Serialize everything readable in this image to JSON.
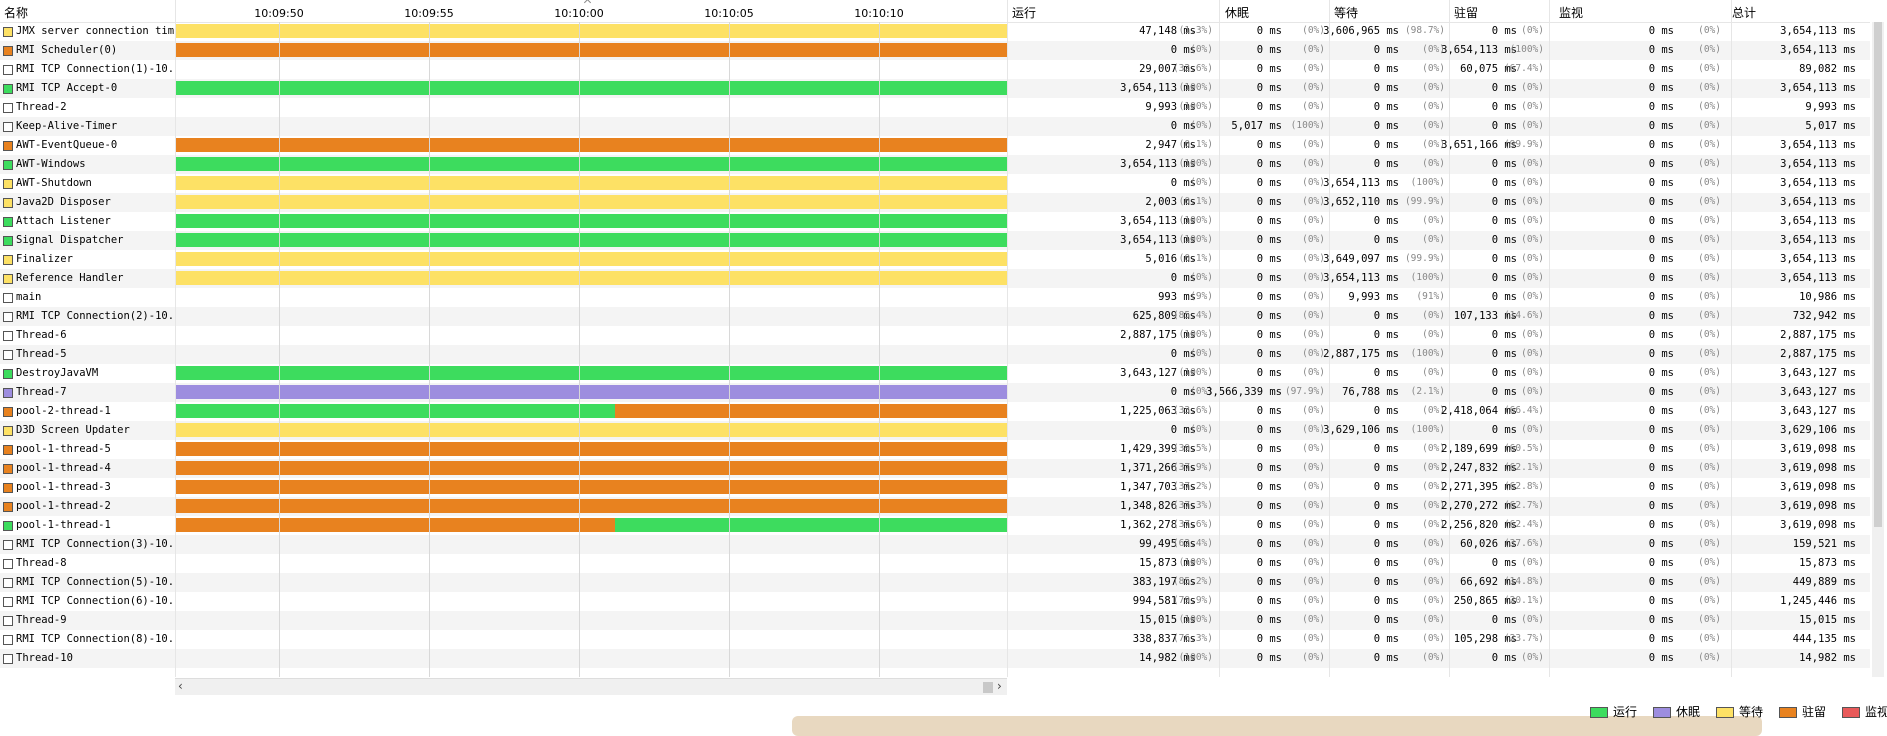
{
  "header": {
    "name_col": "名称",
    "run_col": "运行",
    "sleep_col": "休眠",
    "wait_col": "等待",
    "park_col": "驻留",
    "monitor_col": "监视",
    "total_col": "总计",
    "time_ticks": [
      "10:09:50",
      "10:09:55",
      "10:10:00",
      "10:10:05",
      "10:10:10"
    ]
  },
  "colors": {
    "running": "#3ddc5e",
    "sleeping": "#9d8ddf",
    "waiting": "#fde165",
    "parked": "#e8821f",
    "monitor": "#e85a5a"
  },
  "threads": [
    {
      "name": "JMX server connection timeout",
      "state_color": "#fde165",
      "segments": [
        {
          "state": "waiting",
          "from": 0,
          "to": 1
        }
      ],
      "run": "47,148 ms",
      "run_pct": "(1.3%)",
      "sleep": "0 ms",
      "sleep_pct": "(0%)",
      "wait": "3,606,965 ms",
      "wait_pct": "(98.7%)",
      "park": "0 ms",
      "park_pct": "(0%)",
      "monitor": "0 ms",
      "monitor_pct": "(0%)",
      "total": "3,654,113 ms"
    },
    {
      "name": "RMI Scheduler(0)",
      "state_color": "#e8821f",
      "segments": [
        {
          "state": "parked",
          "from": 0,
          "to": 1
        }
      ],
      "run": "0 ms",
      "run_pct": "(0%)",
      "sleep": "0 ms",
      "sleep_pct": "(0%)",
      "wait": "0 ms",
      "wait_pct": "(0%)",
      "park": "3,654,113 ms",
      "park_pct": "(100%)",
      "monitor": "0 ms",
      "monitor_pct": "(0%)",
      "total": "3,654,113 ms"
    },
    {
      "name": "RMI TCP Connection(1)-10.10",
      "state_color": "#ffffff",
      "segments": [],
      "run": "29,007 ms",
      "run_pct": "(32.6%)",
      "sleep": "0 ms",
      "sleep_pct": "(0%)",
      "wait": "0 ms",
      "wait_pct": "(0%)",
      "park": "60,075 ms",
      "park_pct": "(67.4%)",
      "monitor": "0 ms",
      "monitor_pct": "(0%)",
      "total": "89,082 ms"
    },
    {
      "name": "RMI TCP Accept-0",
      "state_color": "#3ddc5e",
      "segments": [
        {
          "state": "running",
          "from": 0,
          "to": 1
        }
      ],
      "run": "3,654,113 ms",
      "run_pct": "(100%)",
      "sleep": "0 ms",
      "sleep_pct": "(0%)",
      "wait": "0 ms",
      "wait_pct": "(0%)",
      "park": "0 ms",
      "park_pct": "(0%)",
      "monitor": "0 ms",
      "monitor_pct": "(0%)",
      "total": "3,654,113 ms"
    },
    {
      "name": "Thread-2",
      "state_color": "#ffffff",
      "segments": [],
      "run": "9,993 ms",
      "run_pct": "(100%)",
      "sleep": "0 ms",
      "sleep_pct": "(0%)",
      "wait": "0 ms",
      "wait_pct": "(0%)",
      "park": "0 ms",
      "park_pct": "(0%)",
      "monitor": "0 ms",
      "monitor_pct": "(0%)",
      "total": "9,993 ms"
    },
    {
      "name": "Keep-Alive-Timer",
      "state_color": "#ffffff",
      "segments": [],
      "run": "0 ms",
      "run_pct": "(0%)",
      "sleep": "5,017 ms",
      "sleep_pct": "(100%)",
      "wait": "0 ms",
      "wait_pct": "(0%)",
      "park": "0 ms",
      "park_pct": "(0%)",
      "monitor": "0 ms",
      "monitor_pct": "(0%)",
      "total": "5,017 ms"
    },
    {
      "name": "AWT-EventQueue-0",
      "state_color": "#e8821f",
      "segments": [
        {
          "state": "parked",
          "from": 0,
          "to": 1
        }
      ],
      "run": "2,947 ms",
      "run_pct": "(0.1%)",
      "sleep": "0 ms",
      "sleep_pct": "(0%)",
      "wait": "0 ms",
      "wait_pct": "(0%)",
      "park": "3,651,166 ms",
      "park_pct": "(99.9%)",
      "monitor": "0 ms",
      "monitor_pct": "(0%)",
      "total": "3,654,113 ms"
    },
    {
      "name": "AWT-Windows",
      "state_color": "#3ddc5e",
      "segments": [
        {
          "state": "running",
          "from": 0,
          "to": 1
        }
      ],
      "run": "3,654,113 ms",
      "run_pct": "(100%)",
      "sleep": "0 ms",
      "sleep_pct": "(0%)",
      "wait": "0 ms",
      "wait_pct": "(0%)",
      "park": "0 ms",
      "park_pct": "(0%)",
      "monitor": "0 ms",
      "monitor_pct": "(0%)",
      "total": "3,654,113 ms"
    },
    {
      "name": "AWT-Shutdown",
      "state_color": "#fde165",
      "segments": [
        {
          "state": "waiting",
          "from": 0,
          "to": 1
        }
      ],
      "run": "0 ms",
      "run_pct": "(0%)",
      "sleep": "0 ms",
      "sleep_pct": "(0%)",
      "wait": "3,654,113 ms",
      "wait_pct": "(100%)",
      "park": "0 ms",
      "park_pct": "(0%)",
      "monitor": "0 ms",
      "monitor_pct": "(0%)",
      "total": "3,654,113 ms"
    },
    {
      "name": "Java2D Disposer",
      "state_color": "#fde165",
      "segments": [
        {
          "state": "waiting",
          "from": 0,
          "to": 1
        }
      ],
      "run": "2,003 ms",
      "run_pct": "(0.1%)",
      "sleep": "0 ms",
      "sleep_pct": "(0%)",
      "wait": "3,652,110 ms",
      "wait_pct": "(99.9%)",
      "park": "0 ms",
      "park_pct": "(0%)",
      "monitor": "0 ms",
      "monitor_pct": "(0%)",
      "total": "3,654,113 ms"
    },
    {
      "name": "Attach Listener",
      "state_color": "#3ddc5e",
      "segments": [
        {
          "state": "running",
          "from": 0,
          "to": 1
        }
      ],
      "run": "3,654,113 ms",
      "run_pct": "(100%)",
      "sleep": "0 ms",
      "sleep_pct": "(0%)",
      "wait": "0 ms",
      "wait_pct": "(0%)",
      "park": "0 ms",
      "park_pct": "(0%)",
      "monitor": "0 ms",
      "monitor_pct": "(0%)",
      "total": "3,654,113 ms"
    },
    {
      "name": "Signal Dispatcher",
      "state_color": "#3ddc5e",
      "segments": [
        {
          "state": "running",
          "from": 0,
          "to": 1
        }
      ],
      "run": "3,654,113 ms",
      "run_pct": "(100%)",
      "sleep": "0 ms",
      "sleep_pct": "(0%)",
      "wait": "0 ms",
      "wait_pct": "(0%)",
      "park": "0 ms",
      "park_pct": "(0%)",
      "monitor": "0 ms",
      "monitor_pct": "(0%)",
      "total": "3,654,113 ms"
    },
    {
      "name": "Finalizer",
      "state_color": "#fde165",
      "segments": [
        {
          "state": "waiting",
          "from": 0,
          "to": 1
        }
      ],
      "run": "5,016 ms",
      "run_pct": "(0.1%)",
      "sleep": "0 ms",
      "sleep_pct": "(0%)",
      "wait": "3,649,097 ms",
      "wait_pct": "(99.9%)",
      "park": "0 ms",
      "park_pct": "(0%)",
      "monitor": "0 ms",
      "monitor_pct": "(0%)",
      "total": "3,654,113 ms"
    },
    {
      "name": "Reference Handler",
      "state_color": "#fde165",
      "segments": [
        {
          "state": "waiting",
          "from": 0,
          "to": 1
        }
      ],
      "run": "0 ms",
      "run_pct": "(0%)",
      "sleep": "0 ms",
      "sleep_pct": "(0%)",
      "wait": "3,654,113 ms",
      "wait_pct": "(100%)",
      "park": "0 ms",
      "park_pct": "(0%)",
      "monitor": "0 ms",
      "monitor_pct": "(0%)",
      "total": "3,654,113 ms"
    },
    {
      "name": "main",
      "state_color": "#ffffff",
      "segments": [],
      "run": "993 ms",
      "run_pct": "(9%)",
      "sleep": "0 ms",
      "sleep_pct": "(0%)",
      "wait": "9,993 ms",
      "wait_pct": "(91%)",
      "park": "0 ms",
      "park_pct": "(0%)",
      "monitor": "0 ms",
      "monitor_pct": "(0%)",
      "total": "10,986 ms"
    },
    {
      "name": "RMI TCP Connection(2)-10.10",
      "state_color": "#ffffff",
      "segments": [],
      "run": "625,809 ms",
      "run_pct": "(85.4%)",
      "sleep": "0 ms",
      "sleep_pct": "(0%)",
      "wait": "0 ms",
      "wait_pct": "(0%)",
      "park": "107,133 ms",
      "park_pct": "(14.6%)",
      "monitor": "0 ms",
      "monitor_pct": "(0%)",
      "total": "732,942 ms"
    },
    {
      "name": "Thread-6",
      "state_color": "#ffffff",
      "segments": [],
      "run": "2,887,175 ms",
      "run_pct": "(100%)",
      "sleep": "0 ms",
      "sleep_pct": "(0%)",
      "wait": "0 ms",
      "wait_pct": "(0%)",
      "park": "0 ms",
      "park_pct": "(0%)",
      "monitor": "0 ms",
      "monitor_pct": "(0%)",
      "total": "2,887,175 ms"
    },
    {
      "name": "Thread-5",
      "state_color": "#ffffff",
      "segments": [],
      "run": "0 ms",
      "run_pct": "(0%)",
      "sleep": "0 ms",
      "sleep_pct": "(0%)",
      "wait": "2,887,175 ms",
      "wait_pct": "(100%)",
      "park": "0 ms",
      "park_pct": "(0%)",
      "monitor": "0 ms",
      "monitor_pct": "(0%)",
      "total": "2,887,175 ms"
    },
    {
      "name": "DestroyJavaVM",
      "state_color": "#3ddc5e",
      "segments": [
        {
          "state": "running",
          "from": 0,
          "to": 1
        }
      ],
      "run": "3,643,127 ms",
      "run_pct": "(100%)",
      "sleep": "0 ms",
      "sleep_pct": "(0%)",
      "wait": "0 ms",
      "wait_pct": "(0%)",
      "park": "0 ms",
      "park_pct": "(0%)",
      "monitor": "0 ms",
      "monitor_pct": "(0%)",
      "total": "3,643,127 ms"
    },
    {
      "name": "Thread-7",
      "state_color": "#9d8ddf",
      "segments": [
        {
          "state": "sleeping",
          "from": 0,
          "to": 1
        }
      ],
      "run": "0 ms",
      "run_pct": "(0%)",
      "sleep": "3,566,339 ms",
      "sleep_pct": "(97.9%)",
      "wait": "76,788 ms",
      "wait_pct": "(2.1%)",
      "park": "0 ms",
      "park_pct": "(0%)",
      "monitor": "0 ms",
      "monitor_pct": "(0%)",
      "total": "3,643,127 ms"
    },
    {
      "name": "pool-2-thread-1",
      "state_color": "#e8821f",
      "segments": [
        {
          "state": "running",
          "from": 0,
          "to": 0.529
        },
        {
          "state": "parked",
          "from": 0.529,
          "to": 1
        }
      ],
      "run": "1,225,063 ms",
      "run_pct": "(33.6%)",
      "sleep": "0 ms",
      "sleep_pct": "(0%)",
      "wait": "0 ms",
      "wait_pct": "(0%)",
      "park": "2,418,064 ms",
      "park_pct": "(66.4%)",
      "monitor": "0 ms",
      "monitor_pct": "(0%)",
      "total": "3,643,127 ms"
    },
    {
      "name": "D3D Screen Updater",
      "state_color": "#fde165",
      "segments": [
        {
          "state": "waiting",
          "from": 0,
          "to": 1
        }
      ],
      "run": "0 ms",
      "run_pct": "(0%)",
      "sleep": "0 ms",
      "sleep_pct": "(0%)",
      "wait": "3,629,106 ms",
      "wait_pct": "(100%)",
      "park": "0 ms",
      "park_pct": "(0%)",
      "monitor": "0 ms",
      "monitor_pct": "(0%)",
      "total": "3,629,106 ms"
    },
    {
      "name": "pool-1-thread-5",
      "state_color": "#e8821f",
      "segments": [
        {
          "state": "parked",
          "from": 0,
          "to": 1
        }
      ],
      "run": "1,429,399 ms",
      "run_pct": "(39.5%)",
      "sleep": "0 ms",
      "sleep_pct": "(0%)",
      "wait": "0 ms",
      "wait_pct": "(0%)",
      "park": "2,189,699 ms",
      "park_pct": "(60.5%)",
      "monitor": "0 ms",
      "monitor_pct": "(0%)",
      "total": "3,619,098 ms"
    },
    {
      "name": "pool-1-thread-4",
      "state_color": "#e8821f",
      "segments": [
        {
          "state": "parked",
          "from": 0,
          "to": 1
        }
      ],
      "run": "1,371,266 ms",
      "run_pct": "(37.9%)",
      "sleep": "0 ms",
      "sleep_pct": "(0%)",
      "wait": "0 ms",
      "wait_pct": "(0%)",
      "park": "2,247,832 ms",
      "park_pct": "(62.1%)",
      "monitor": "0 ms",
      "monitor_pct": "(0%)",
      "total": "3,619,098 ms"
    },
    {
      "name": "pool-1-thread-3",
      "state_color": "#e8821f",
      "segments": [
        {
          "state": "parked",
          "from": 0,
          "to": 1
        }
      ],
      "run": "1,347,703 ms",
      "run_pct": "(37.2%)",
      "sleep": "0 ms",
      "sleep_pct": "(0%)",
      "wait": "0 ms",
      "wait_pct": "(0%)",
      "park": "2,271,395 ms",
      "park_pct": "(62.8%)",
      "monitor": "0 ms",
      "monitor_pct": "(0%)",
      "total": "3,619,098 ms"
    },
    {
      "name": "pool-1-thread-2",
      "state_color": "#e8821f",
      "segments": [
        {
          "state": "parked",
          "from": 0,
          "to": 1
        }
      ],
      "run": "1,348,826 ms",
      "run_pct": "(37.3%)",
      "sleep": "0 ms",
      "sleep_pct": "(0%)",
      "wait": "0 ms",
      "wait_pct": "(0%)",
      "park": "2,270,272 ms",
      "park_pct": "(62.7%)",
      "monitor": "0 ms",
      "monitor_pct": "(0%)",
      "total": "3,619,098 ms"
    },
    {
      "name": "pool-1-thread-1",
      "state_color": "#3ddc5e",
      "segments": [
        {
          "state": "parked",
          "from": 0,
          "to": 0.529
        },
        {
          "state": "running",
          "from": 0.529,
          "to": 1
        }
      ],
      "run": "1,362,278 ms",
      "run_pct": "(37.6%)",
      "sleep": "0 ms",
      "sleep_pct": "(0%)",
      "wait": "0 ms",
      "wait_pct": "(0%)",
      "park": "2,256,820 ms",
      "park_pct": "(62.4%)",
      "monitor": "0 ms",
      "monitor_pct": "(0%)",
      "total": "3,619,098 ms"
    },
    {
      "name": "RMI TCP Connection(3)-10.10",
      "state_color": "#ffffff",
      "segments": [],
      "run": "99,495 ms",
      "run_pct": "(62.4%)",
      "sleep": "0 ms",
      "sleep_pct": "(0%)",
      "wait": "0 ms",
      "wait_pct": "(0%)",
      "park": "60,026 ms",
      "park_pct": "(37.6%)",
      "monitor": "0 ms",
      "monitor_pct": "(0%)",
      "total": "159,521 ms"
    },
    {
      "name": "Thread-8",
      "state_color": "#ffffff",
      "segments": [],
      "run": "15,873 ms",
      "run_pct": "(100%)",
      "sleep": "0 ms",
      "sleep_pct": "(0%)",
      "wait": "0 ms",
      "wait_pct": "(0%)",
      "park": "0 ms",
      "park_pct": "(0%)",
      "monitor": "0 ms",
      "monitor_pct": "(0%)",
      "total": "15,873 ms"
    },
    {
      "name": "RMI TCP Connection(5)-10.10",
      "state_color": "#ffffff",
      "segments": [],
      "run": "383,197 ms",
      "run_pct": "(85.2%)",
      "sleep": "0 ms",
      "sleep_pct": "(0%)",
      "wait": "0 ms",
      "wait_pct": "(0%)",
      "park": "66,692 ms",
      "park_pct": "(14.8%)",
      "monitor": "0 ms",
      "monitor_pct": "(0%)",
      "total": "449,889 ms"
    },
    {
      "name": "RMI TCP Connection(6)-10.10",
      "state_color": "#ffffff",
      "segments": [],
      "run": "994,581 ms",
      "run_pct": "(79.9%)",
      "sleep": "0 ms",
      "sleep_pct": "(0%)",
      "wait": "0 ms",
      "wait_pct": "(0%)",
      "park": "250,865 ms",
      "park_pct": "(20.1%)",
      "monitor": "0 ms",
      "monitor_pct": "(0%)",
      "total": "1,245,446 ms"
    },
    {
      "name": "Thread-9",
      "state_color": "#ffffff",
      "segments": [],
      "run": "15,015 ms",
      "run_pct": "(100%)",
      "sleep": "0 ms",
      "sleep_pct": "(0%)",
      "wait": "0 ms",
      "wait_pct": "(0%)",
      "park": "0 ms",
      "park_pct": "(0%)",
      "monitor": "0 ms",
      "monitor_pct": "(0%)",
      "total": "15,015 ms"
    },
    {
      "name": "RMI TCP Connection(8)-10.10",
      "state_color": "#ffffff",
      "segments": [],
      "run": "338,837 ms",
      "run_pct": "(76.3%)",
      "sleep": "0 ms",
      "sleep_pct": "(0%)",
      "wait": "0 ms",
      "wait_pct": "(0%)",
      "park": "105,298 ms",
      "park_pct": "(23.7%)",
      "monitor": "0 ms",
      "monitor_pct": "(0%)",
      "total": "444,135 ms"
    },
    {
      "name": "Thread-10",
      "state_color": "#ffffff",
      "segments": [],
      "run": "14,982 ms",
      "run_pct": "(100%)",
      "sleep": "0 ms",
      "sleep_pct": "(0%)",
      "wait": "0 ms",
      "wait_pct": "(0%)",
      "park": "0 ms",
      "park_pct": "(0%)",
      "monitor": "0 ms",
      "monitor_pct": "(0%)",
      "total": "14,982 ms"
    }
  ],
  "legend": [
    {
      "label": "运行",
      "color": "#3ddc5e"
    },
    {
      "label": "休眠",
      "color": "#9d8ddf"
    },
    {
      "label": "等待",
      "color": "#fde165"
    },
    {
      "label": "驻留",
      "color": "#e8821f"
    },
    {
      "label": "监视",
      "color": "#e85a5a"
    }
  ],
  "scroll": {
    "left_arrow": "‹",
    "right_arrow": "›"
  }
}
